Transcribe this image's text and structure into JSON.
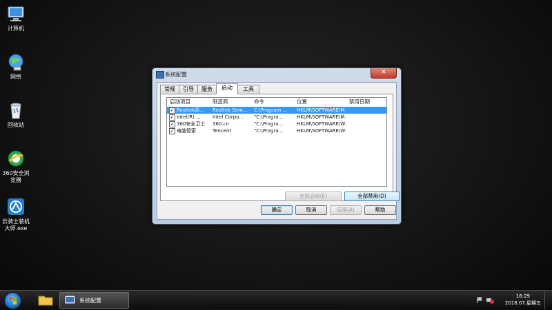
{
  "desktop": {
    "icons": [
      {
        "label": "计算机",
        "icon": "computer-icon"
      },
      {
        "label": "网络",
        "icon": "network-icon"
      },
      {
        "label": "回收站",
        "icon": "recycle-bin-icon"
      },
      {
        "label": "360安全浏览器",
        "icon": "360-browser-icon"
      },
      {
        "label": "云骑士装机大师.exe",
        "icon": "yunqishi-installer-icon"
      }
    ]
  },
  "dialog": {
    "title": "系统配置",
    "close_label": "✕",
    "tabs": [
      "常规",
      "引导",
      "服务",
      "启动",
      "工具"
    ],
    "active_tab": "启动",
    "columns": [
      "启动项目",
      "制造商",
      "命令",
      "位置",
      "禁用日期"
    ],
    "rows": [
      {
        "checked": true,
        "item": "Realtek高...",
        "maker": "Realtek Sem...",
        "command": "C:\\Program ...",
        "location": "HKLM\\SOFTWARE\\M...",
        "date": ""
      },
      {
        "checked": true,
        "item": "Intel(R) ...",
        "maker": "Intel Corpo...",
        "command": "\"C:\\Progra...",
        "location": "HKLM\\SOFTWARE\\M...",
        "date": ""
      },
      {
        "checked": true,
        "item": "360安全卫士",
        "maker": "360.cn",
        "command": "\"C:\\Progra...",
        "location": "HKLM\\SOFTWARE\\W...",
        "date": ""
      },
      {
        "checked": true,
        "item": "电脑管家",
        "maker": "Tencent",
        "command": "\"C:\\Progra...",
        "location": "HKLM\\SOFTWARE\\W...",
        "date": ""
      }
    ],
    "enable_all_label": "全部启用(E)",
    "disable_all_label": "全部禁用(D)",
    "ok_label": "确定",
    "cancel_label": "取消",
    "apply_label": "应用(A)",
    "help_label": "帮助"
  },
  "taskbar": {
    "active_app_label": "系统配置",
    "time": "16:29",
    "date": "2018.07.星期五"
  },
  "colors": {
    "selection": "#3399ff",
    "dialog_frame": "#b9cce0",
    "desktop_bg": "#151515"
  }
}
